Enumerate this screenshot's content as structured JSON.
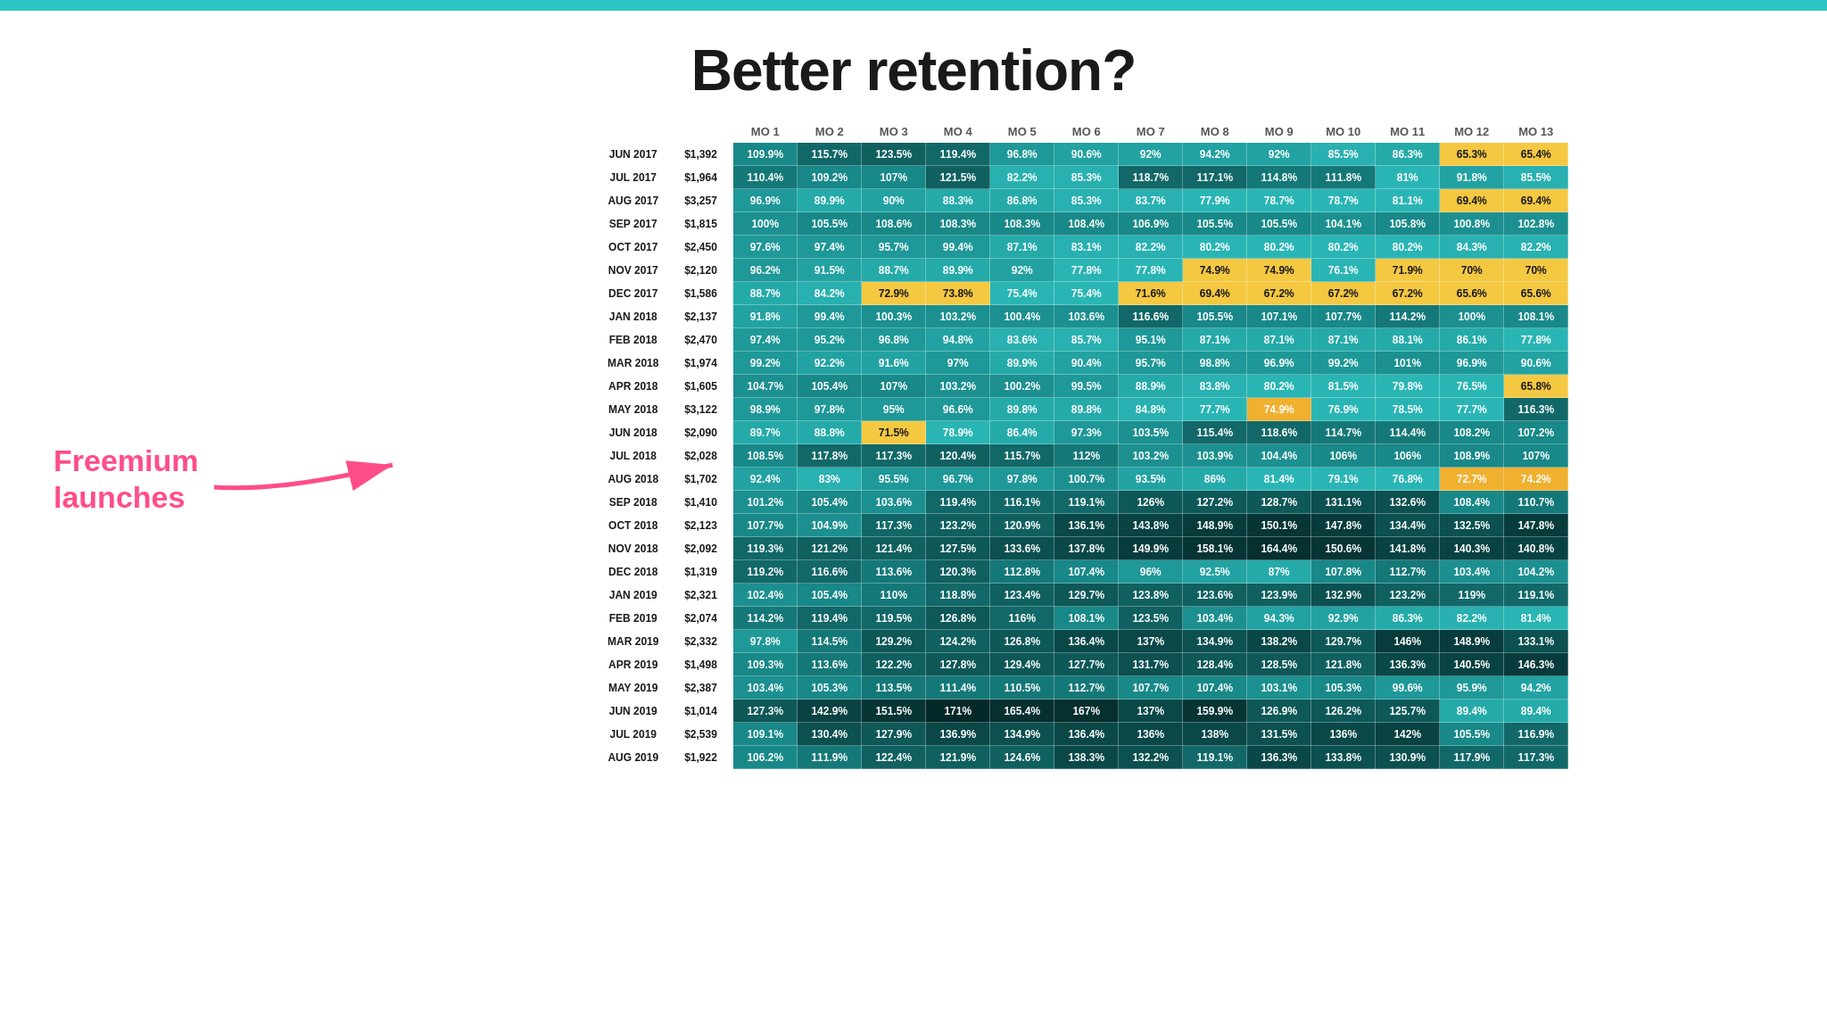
{
  "title": "Better retention?",
  "topBar": {
    "color": "#2ec4c4"
  },
  "annotation": {
    "freemiumLabel": "Freemium launches",
    "arrowColor": "#ff4d88"
  },
  "columns": [
    "MO 1",
    "MO 2",
    "MO 3",
    "MO 4",
    "MO 5",
    "MO 6",
    "MO 7",
    "MO 8",
    "MO 9",
    "MO 10",
    "MO 11",
    "MO 12",
    "MO 13"
  ],
  "rows": [
    {
      "label": "JUN 2017",
      "value": "$1,392",
      "cells": [
        "109.9%",
        "115.7%",
        "123.5%",
        "119.4%",
        "96.8%",
        "90.6%",
        "92%",
        "94.2%",
        "92%",
        "85.5%",
        "86.3%",
        "65.3%",
        "65.4%"
      ]
    },
    {
      "label": "JUL 2017",
      "value": "$1,964",
      "cells": [
        "110.4%",
        "109.2%",
        "107%",
        "121.5%",
        "82.2%",
        "85.3%",
        "118.7%",
        "117.1%",
        "114.8%",
        "111.8%",
        "81%",
        "91.8%",
        "85.5%"
      ]
    },
    {
      "label": "AUG 2017",
      "value": "$3,257",
      "cells": [
        "96.9%",
        "89.9%",
        "90%",
        "88.3%",
        "86.8%",
        "85.3%",
        "83.7%",
        "77.9%",
        "78.7%",
        "78.7%",
        "81.1%",
        "69.4%",
        "69.4%"
      ]
    },
    {
      "label": "SEP 2017",
      "value": "$1,815",
      "cells": [
        "100%",
        "105.5%",
        "108.6%",
        "108.3%",
        "108.3%",
        "108.4%",
        "106.9%",
        "105.5%",
        "105.5%",
        "104.1%",
        "105.8%",
        "100.8%",
        "102.8%"
      ]
    },
    {
      "label": "OCT 2017",
      "value": "$2,450",
      "cells": [
        "97.6%",
        "97.4%",
        "95.7%",
        "99.4%",
        "87.1%",
        "83.1%",
        "82.2%",
        "80.2%",
        "80.2%",
        "80.2%",
        "80.2%",
        "84.3%",
        "82.2%"
      ]
    },
    {
      "label": "NOV 2017",
      "value": "$2,120",
      "cells": [
        "96.2%",
        "91.5%",
        "88.7%",
        "89.9%",
        "92%",
        "77.8%",
        "77.8%",
        "74.9%",
        "74.9%",
        "76.1%",
        "71.9%",
        "70%",
        "70%"
      ]
    },
    {
      "label": "DEC 2017",
      "value": "$1,586",
      "cells": [
        "88.7%",
        "84.2%",
        "72.9%",
        "73.8%",
        "75.4%",
        "75.4%",
        "71.6%",
        "69.4%",
        "67.2%",
        "67.2%",
        "67.2%",
        "65.6%",
        "65.6%"
      ]
    },
    {
      "label": "JAN 2018",
      "value": "$2,137",
      "cells": [
        "91.8%",
        "99.4%",
        "100.3%",
        "103.2%",
        "100.4%",
        "103.6%",
        "116.6%",
        "105.5%",
        "107.1%",
        "107.7%",
        "114.2%",
        "100%",
        "108.1%"
      ]
    },
    {
      "label": "FEB 2018",
      "value": "$2,470",
      "cells": [
        "97.4%",
        "95.2%",
        "96.8%",
        "94.8%",
        "83.6%",
        "85.7%",
        "95.1%",
        "87.1%",
        "87.1%",
        "87.1%",
        "88.1%",
        "86.1%",
        "77.8%"
      ]
    },
    {
      "label": "MAR 2018",
      "value": "$1,974",
      "cells": [
        "99.2%",
        "92.2%",
        "91.6%",
        "97%",
        "89.9%",
        "90.4%",
        "95.7%",
        "98.8%",
        "96.9%",
        "99.2%",
        "101%",
        "96.9%",
        "90.6%"
      ]
    },
    {
      "label": "APR 2018",
      "value": "$1,605",
      "cells": [
        "104.7%",
        "105.4%",
        "107%",
        "103.2%",
        "100.2%",
        "99.5%",
        "88.9%",
        "83.8%",
        "80.2%",
        "81.5%",
        "79.8%",
        "76.5%",
        "65.8%"
      ]
    },
    {
      "label": "MAY 2018",
      "value": "$3,122",
      "cells": [
        "98.9%",
        "97.8%",
        "95%",
        "96.6%",
        "89.8%",
        "89.8%",
        "84.8%",
        "77.7%",
        "74.9%",
        "76.9%",
        "78.5%",
        "77.7%",
        "116.3%"
      ]
    },
    {
      "label": "JUN 2018",
      "value": "$2,090",
      "cells": [
        "89.7%",
        "88.8%",
        "71.5%",
        "78.9%",
        "86.4%",
        "97.3%",
        "103.5%",
        "115.4%",
        "118.6%",
        "114.7%",
        "114.4%",
        "108.2%",
        "107.2%"
      ]
    },
    {
      "label": "JUL 2018",
      "value": "$2,028",
      "cells": [
        "108.5%",
        "117.8%",
        "117.3%",
        "120.4%",
        "115.7%",
        "112%",
        "103.2%",
        "103.9%",
        "104.4%",
        "106%",
        "106%",
        "108.9%",
        "107%"
      ]
    },
    {
      "label": "AUG 2018",
      "value": "$1,702",
      "cells": [
        "92.4%",
        "83%",
        "95.5%",
        "96.7%",
        "97.8%",
        "100.7%",
        "93.5%",
        "86%",
        "81.4%",
        "79.1%",
        "76.8%",
        "72.7%",
        "74.2%"
      ]
    },
    {
      "label": "SEP 2018",
      "value": "$1,410",
      "cells": [
        "101.2%",
        "105.4%",
        "103.6%",
        "119.4%",
        "116.1%",
        "119.1%",
        "126%",
        "127.2%",
        "128.7%",
        "131.1%",
        "132.6%",
        "108.4%",
        "110.7%"
      ]
    },
    {
      "label": "OCT 2018",
      "value": "$2,123",
      "cells": [
        "107.7%",
        "104.9%",
        "117.3%",
        "123.2%",
        "120.9%",
        "136.1%",
        "143.8%",
        "148.9%",
        "150.1%",
        "147.8%",
        "134.4%",
        "132.5%",
        "147.8%"
      ]
    },
    {
      "label": "NOV 2018",
      "value": "$2,092",
      "cells": [
        "119.3%",
        "121.2%",
        "121.4%",
        "127.5%",
        "133.6%",
        "137.8%",
        "149.9%",
        "158.1%",
        "164.4%",
        "150.6%",
        "141.8%",
        "140.3%",
        "140.8%"
      ]
    },
    {
      "label": "DEC 2018",
      "value": "$1,319",
      "cells": [
        "119.2%",
        "116.6%",
        "113.6%",
        "120.3%",
        "112.8%",
        "107.4%",
        "96%",
        "92.5%",
        "87%",
        "107.8%",
        "112.7%",
        "103.4%",
        "104.2%"
      ]
    },
    {
      "label": "JAN 2019",
      "value": "$2,321",
      "cells": [
        "102.4%",
        "105.4%",
        "110%",
        "118.8%",
        "123.4%",
        "129.7%",
        "123.8%",
        "123.6%",
        "123.9%",
        "132.9%",
        "123.2%",
        "119%",
        "119.1%"
      ]
    },
    {
      "label": "FEB 2019",
      "value": "$2,074",
      "cells": [
        "114.2%",
        "119.4%",
        "119.5%",
        "126.8%",
        "116%",
        "108.1%",
        "123.5%",
        "103.4%",
        "94.3%",
        "92.9%",
        "86.3%",
        "82.2%",
        "81.4%"
      ]
    },
    {
      "label": "MAR 2019",
      "value": "$2,332",
      "cells": [
        "97.8%",
        "114.5%",
        "129.2%",
        "124.2%",
        "126.8%",
        "136.4%",
        "137%",
        "134.9%",
        "138.2%",
        "129.7%",
        "146%",
        "148.9%",
        "133.1%"
      ]
    },
    {
      "label": "APR 2019",
      "value": "$1,498",
      "cells": [
        "109.3%",
        "113.6%",
        "122.2%",
        "127.8%",
        "129.4%",
        "127.7%",
        "131.7%",
        "128.4%",
        "128.5%",
        "121.8%",
        "136.3%",
        "140.5%",
        "146.3%"
      ]
    },
    {
      "label": "MAY 2019",
      "value": "$2,387",
      "cells": [
        "103.4%",
        "105.3%",
        "113.5%",
        "111.4%",
        "110.5%",
        "112.7%",
        "107.7%",
        "107.4%",
        "103.1%",
        "105.3%",
        "99.6%",
        "95.9%",
        "94.2%"
      ]
    },
    {
      "label": "JUN 2019",
      "value": "$1,014",
      "cells": [
        "127.3%",
        "142.9%",
        "151.5%",
        "171%",
        "165.4%",
        "167%",
        "137%",
        "159.9%",
        "126.9%",
        "126.2%",
        "125.7%",
        "89.4%",
        "89.4%"
      ]
    },
    {
      "label": "JUL 2019",
      "value": "$2,539",
      "cells": [
        "109.1%",
        "130.4%",
        "127.9%",
        "136.9%",
        "134.9%",
        "136.4%",
        "136%",
        "138%",
        "131.5%",
        "136%",
        "142%",
        "105.5%",
        "116.9%"
      ]
    },
    {
      "label": "AUG 2019",
      "value": "$1,922",
      "cells": [
        "106.2%",
        "111.9%",
        "122.4%",
        "121.9%",
        "124.6%",
        "138.3%",
        "132.2%",
        "119.1%",
        "136.3%",
        "133.8%",
        "130.9%",
        "117.9%",
        "117.3%"
      ]
    }
  ]
}
